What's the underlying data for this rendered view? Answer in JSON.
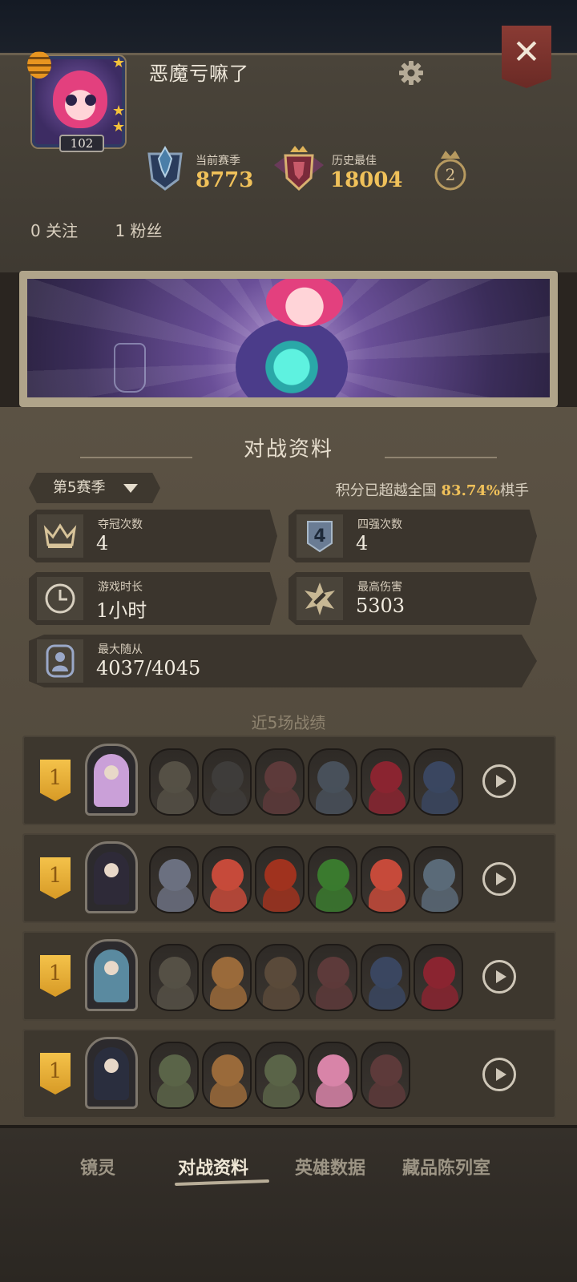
{
  "profile": {
    "username": "恶魔亏嘛了",
    "level": "102",
    "current_season_label": "当前赛季",
    "current_season_score": "8773",
    "best_label": "历史最佳",
    "best_score": "18004",
    "crown_count": "2",
    "following": "0 关注",
    "followers": "1 粉丝"
  },
  "icons": {
    "settings": "gear-icon",
    "close": "close-icon",
    "season_rank": "blue-crystal-rank-icon",
    "best_rank": "crown-shield-rank-icon",
    "crown_badge": "crown-count-icon"
  },
  "colors": {
    "accent_gold": "#f0c15a",
    "close_red": "#8a3b34",
    "card_bg": "#3b352d"
  },
  "battle": {
    "section_title": "对战资料",
    "season_select": "第5赛季",
    "beat_prefix": "积分已超越全国 ",
    "beat_pct": "83.74%",
    "beat_suffix": "棋手",
    "stats": [
      {
        "label": "夺冠次数",
        "value": "4",
        "icon": "crown-icon"
      },
      {
        "label": "四强次数",
        "value": "4",
        "icon": "top4-shield-icon"
      },
      {
        "label": "游戏时长",
        "value": "1小时",
        "icon": "clock-icon"
      },
      {
        "label": "最高伤害",
        "value": "5303",
        "icon": "damage-burst-icon"
      },
      {
        "label": "最大随从",
        "value": "4037/4045",
        "icon": "minion-icon"
      }
    ],
    "recent_title": "近5场战绩"
  },
  "matches": [
    {
      "rank": "1",
      "hero_color": "#caa0d8",
      "units": [
        "#555045",
        "#3e3c3a",
        "#5d3a3a",
        "#48505a",
        "#8a2430",
        "#3a4660"
      ]
    },
    {
      "rank": "1",
      "hero_color": "#2e2a38",
      "units": [
        "#6b7080",
        "#c64a3a",
        "#a0321e",
        "#3a7a2e",
        "#c64a3a",
        "#5a6a78"
      ]
    },
    {
      "rank": "1",
      "hero_color": "#5a8aa0",
      "units": [
        "#555045",
        "#9a6a3a",
        "#5a4a3a",
        "#5d3a3a",
        "#3a4660",
        "#8a2430"
      ]
    },
    {
      "rank": "1",
      "hero_color": "#2a2e3e",
      "units": [
        "#5a6448",
        "#9a6a3a",
        "#5a6448",
        "#d884a8",
        "#5d3a3a"
      ]
    }
  ],
  "nav": {
    "items": [
      "镜灵",
      "对战资料",
      "英雄数据",
      "藏品陈列室"
    ]
  }
}
